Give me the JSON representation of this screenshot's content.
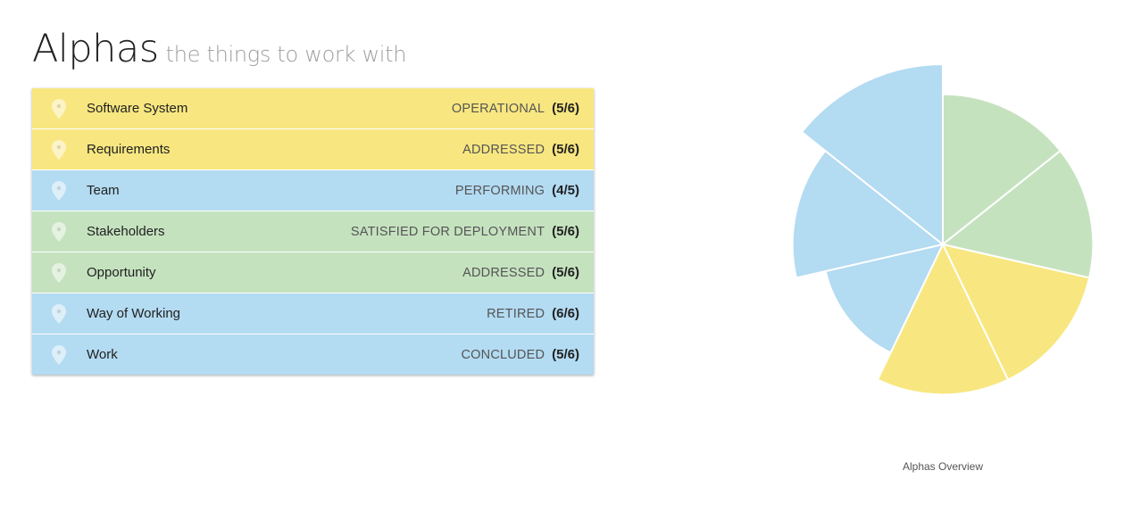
{
  "header": {
    "title": "Alphas",
    "subtitle": "the things to work with"
  },
  "colors": {
    "yellow": "#f8e780",
    "blue": "#b3dbf2",
    "green": "#c5e2bf"
  },
  "alphas": [
    {
      "name": "Software System",
      "state": "OPERATIONAL",
      "progress": "(5/6)",
      "color": "#f8e780",
      "icon": "map-pin-icon"
    },
    {
      "name": "Requirements",
      "state": "ADDRESSED",
      "progress": "(5/6)",
      "color": "#f8e780",
      "icon": "map-pin-icon"
    },
    {
      "name": "Team",
      "state": "PERFORMING",
      "progress": "(4/5)",
      "color": "#b3dbf2",
      "icon": "map-pin-icon"
    },
    {
      "name": "Stakeholders",
      "state": "SATISFIED FOR DEPLOYMENT",
      "progress": "(5/6)",
      "color": "#c5e2bf",
      "icon": "map-pin-icon"
    },
    {
      "name": "Opportunity",
      "state": "ADDRESSED",
      "progress": "(5/6)",
      "color": "#c5e2bf",
      "icon": "map-pin-icon"
    },
    {
      "name": "Way of Working",
      "state": "RETIRED",
      "progress": "(6/6)",
      "color": "#b3dbf2",
      "icon": "map-pin-icon"
    },
    {
      "name": "Work",
      "state": "CONCLUDED",
      "progress": "(5/6)",
      "color": "#b3dbf2",
      "icon": "map-pin-icon"
    }
  ],
  "chart_data": {
    "type": "polar-area",
    "title": "Alphas Overview",
    "categories": [
      "Stakeholders",
      "Opportunity",
      "Requirements",
      "Software System",
      "Team",
      "Work",
      "Way of Working"
    ],
    "values": [
      5,
      5,
      5,
      5,
      4,
      5,
      6
    ],
    "max": [
      6,
      6,
      6,
      6,
      5,
      6,
      6
    ],
    "colors": [
      "#c5e2bf",
      "#c5e2bf",
      "#f8e780",
      "#f8e780",
      "#b3dbf2",
      "#b3dbf2",
      "#b3dbf2"
    ]
  }
}
